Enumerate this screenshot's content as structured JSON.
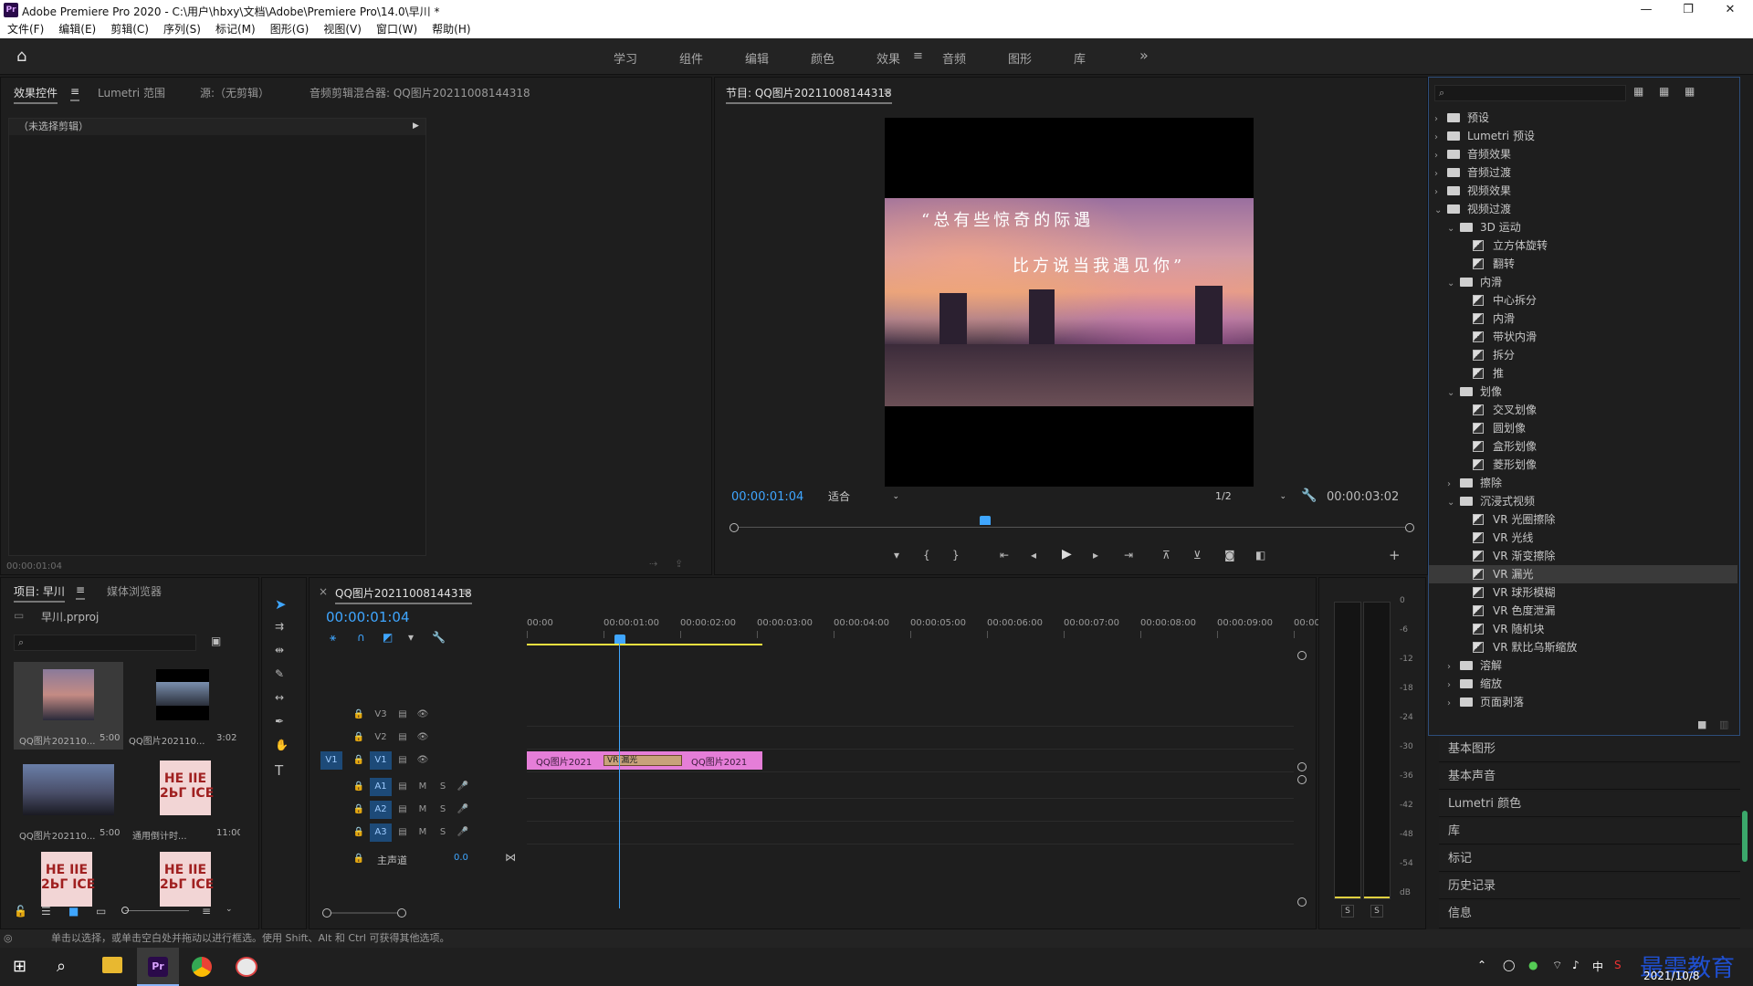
{
  "window": {
    "logo": "Pr",
    "title": "Adobe Premiere Pro 2020 - C:\\用户\\hbxy\\文档\\Adobe\\Premiere Pro\\14.0\\早川 *",
    "min": "—",
    "max": "❐",
    "close": "✕"
  },
  "menu": [
    "文件(F)",
    "编辑(E)",
    "剪辑(C)",
    "序列(S)",
    "标记(M)",
    "图形(G)",
    "视图(V)",
    "窗口(W)",
    "帮助(H)"
  ],
  "workspaces": [
    "学习",
    "组件",
    "编辑",
    "颜色",
    "效果",
    "音频",
    "图形",
    "库"
  ],
  "workspace_active": "效果",
  "workspace_menu": "≡",
  "workspace_more": "»",
  "source_panel": {
    "tabs": [
      "效果控件",
      "Lumetri 范围",
      "源:（无剪辑）",
      "音频剪辑混合器: QQ图片20211008144318"
    ],
    "tab_menu": "≡",
    "no_clip": "（未选择剪辑）",
    "timecode": "00:00:01:04"
  },
  "program": {
    "title": "节目: QQ图片20211008144318",
    "menu": "≡",
    "line1": "“总有些惊奇的际遇",
    "line2": "比方说当我遇见你”",
    "timecode": "00:00:01:04",
    "fit": "适合",
    "quality": "1/2",
    "duration": "00:00:03:02",
    "playhead_fraction": 0.37
  },
  "effects": {
    "search_placeholder": "",
    "items": [
      {
        "level": 0,
        "type": "folder",
        "arrow": "›",
        "label": "预设"
      },
      {
        "level": 0,
        "type": "folder",
        "arrow": "›",
        "label": "Lumetri 预设"
      },
      {
        "level": 0,
        "type": "folder",
        "arrow": "›",
        "label": "音频效果"
      },
      {
        "level": 0,
        "type": "folder",
        "arrow": "›",
        "label": "音频过渡"
      },
      {
        "level": 0,
        "type": "folder",
        "arrow": "›",
        "label": "视频效果"
      },
      {
        "level": 0,
        "type": "folder",
        "arrow": "⌄",
        "label": "视频过渡"
      },
      {
        "level": 1,
        "type": "folder",
        "arrow": "⌄",
        "label": "3D 运动"
      },
      {
        "level": 2,
        "type": "fx",
        "label": "立方体旋转"
      },
      {
        "level": 2,
        "type": "fx",
        "label": "翻转"
      },
      {
        "level": 1,
        "type": "folder",
        "arrow": "⌄",
        "label": "内滑"
      },
      {
        "level": 2,
        "type": "fx",
        "label": "中心拆分"
      },
      {
        "level": 2,
        "type": "fx",
        "label": "内滑"
      },
      {
        "level": 2,
        "type": "fx",
        "label": "带状内滑"
      },
      {
        "level": 2,
        "type": "fx",
        "label": "拆分"
      },
      {
        "level": 2,
        "type": "fx",
        "label": "推"
      },
      {
        "level": 1,
        "type": "folder",
        "arrow": "⌄",
        "label": "划像"
      },
      {
        "level": 2,
        "type": "fx",
        "label": "交叉划像"
      },
      {
        "level": 2,
        "type": "fx",
        "label": "圆划像"
      },
      {
        "level": 2,
        "type": "fx",
        "label": "盒形划像"
      },
      {
        "level": 2,
        "type": "fx",
        "label": "菱形划像"
      },
      {
        "level": 1,
        "type": "folder",
        "arrow": "›",
        "label": "擦除"
      },
      {
        "level": 1,
        "type": "folder",
        "arrow": "⌄",
        "label": "沉浸式视频"
      },
      {
        "level": 2,
        "type": "fx",
        "label": "VR 光圈擦除"
      },
      {
        "level": 2,
        "type": "fx",
        "label": "VR 光线"
      },
      {
        "level": 2,
        "type": "fx",
        "label": "VR 渐变擦除"
      },
      {
        "level": 2,
        "type": "fx",
        "label": "VR 漏光",
        "selected": true
      },
      {
        "level": 2,
        "type": "fx",
        "label": "VR 球形模糊"
      },
      {
        "level": 2,
        "type": "fx",
        "label": "VR 色度泄漏"
      },
      {
        "level": 2,
        "type": "fx",
        "label": "VR 随机块"
      },
      {
        "level": 2,
        "type": "fx",
        "label": "VR 默比乌斯缩放"
      },
      {
        "level": 1,
        "type": "folder",
        "arrow": "›",
        "label": "溶解"
      },
      {
        "level": 1,
        "type": "folder",
        "arrow": "›",
        "label": "缩放"
      },
      {
        "level": 1,
        "type": "folder",
        "arrow": "›",
        "label": "页面剥落"
      }
    ]
  },
  "right_panels": [
    "基本图形",
    "基本声音",
    "Lumetri 颜色",
    "库",
    "标记",
    "历史记录",
    "信息"
  ],
  "project": {
    "tabs": [
      "项目: 早川",
      "媒体浏览器"
    ],
    "tab_menu": "≡",
    "file": "早川.prproj",
    "thumbs": [
      {
        "name": "QQ图片202110...",
        "dur": "5:00"
      },
      {
        "name": "QQ图片202110...",
        "dur": "3:02"
      },
      {
        "name": "QQ图片202110...",
        "dur": "5:00"
      },
      {
        "name": "通用倒计时...",
        "dur": "11:00"
      },
      {
        "name": "",
        "dur": ""
      },
      {
        "name": "",
        "dur": ""
      }
    ],
    "leader_text": "HE IIE\n2ЬГ ICE"
  },
  "timeline": {
    "title": "QQ图片20211008144318",
    "close": "×",
    "menu": "≡",
    "timecode": "00:00:01:04",
    "ruler": [
      "00:00",
      "00:00:01:00",
      "00:00:02:00",
      "00:00:03:00",
      "00:00:04:00",
      "00:00:05:00",
      "00:00:06:00",
      "00:00:07:00",
      "00:00:08:00",
      "00:00:09:00",
      "00:00:"
    ],
    "tracks_v": [
      "V3",
      "V2",
      "V1"
    ],
    "tracks_a": [
      "A1",
      "A2",
      "A3"
    ],
    "source_v1": "V1",
    "master": "主声道",
    "master_val": "0.0",
    "clip1": "QQ图片2021",
    "clip2": "QQ图片2021",
    "transition": "VR 漏光",
    "m": "M",
    "s": "S"
  },
  "meter": {
    "ticks": [
      "0",
      "-6",
      "-12",
      "-18",
      "-24",
      "-30",
      "-36",
      "-42",
      "-48",
      "-54",
      "dB"
    ],
    "solo_l": "S",
    "solo_r": "S"
  },
  "status": "单击以选择，或单击空白处并拖动以进行框选。使用 Shift、Alt 和 Ctrl 可获得其他选项。",
  "taskbar": {
    "ime": "中",
    "watermark": "最需教育",
    "date": "2021/10/8"
  },
  "colors": {
    "accent": "#3fa6ff",
    "clip": "#e57ed8",
    "transition": "#c8a27a",
    "workarea": "#f0e040"
  }
}
